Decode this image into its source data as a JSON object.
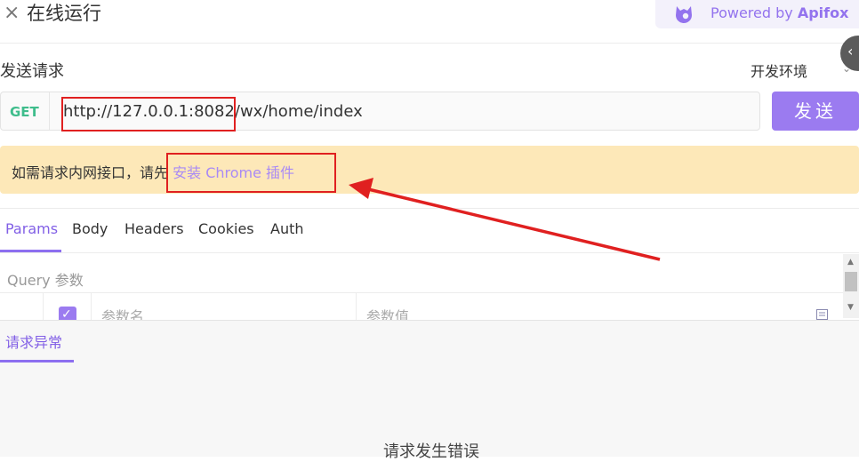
{
  "header": {
    "close_icon": "close-icon",
    "title": "在线运行",
    "powered_by": "Powered by",
    "brand": "Apifox",
    "brand_color": "#9373ee",
    "collapse_glyph": "‹"
  },
  "request": {
    "section_label": "发送请求",
    "environment": "开发环境",
    "method": "GET",
    "url": "http://127.0.0.1:8082/wx/home/index",
    "send_label": "发送"
  },
  "banner": {
    "text": "如需请求内网接口，请先",
    "link": "安装 Chrome 插件"
  },
  "tabs": [
    "Params",
    "Body",
    "Headers",
    "Cookies",
    "Auth"
  ],
  "params": {
    "section_label": "Query 参数",
    "name_placeholder": "参数名",
    "value_placeholder": "参数值",
    "checkbox_checked": true
  },
  "response": {
    "tab_label": "请求异常",
    "message": "请求发生错误"
  },
  "colors": {
    "accent": "#9b7bf0",
    "method_get": "#3fbd8c",
    "banner_bg": "#fde8b8",
    "annotation": "#e02020"
  }
}
